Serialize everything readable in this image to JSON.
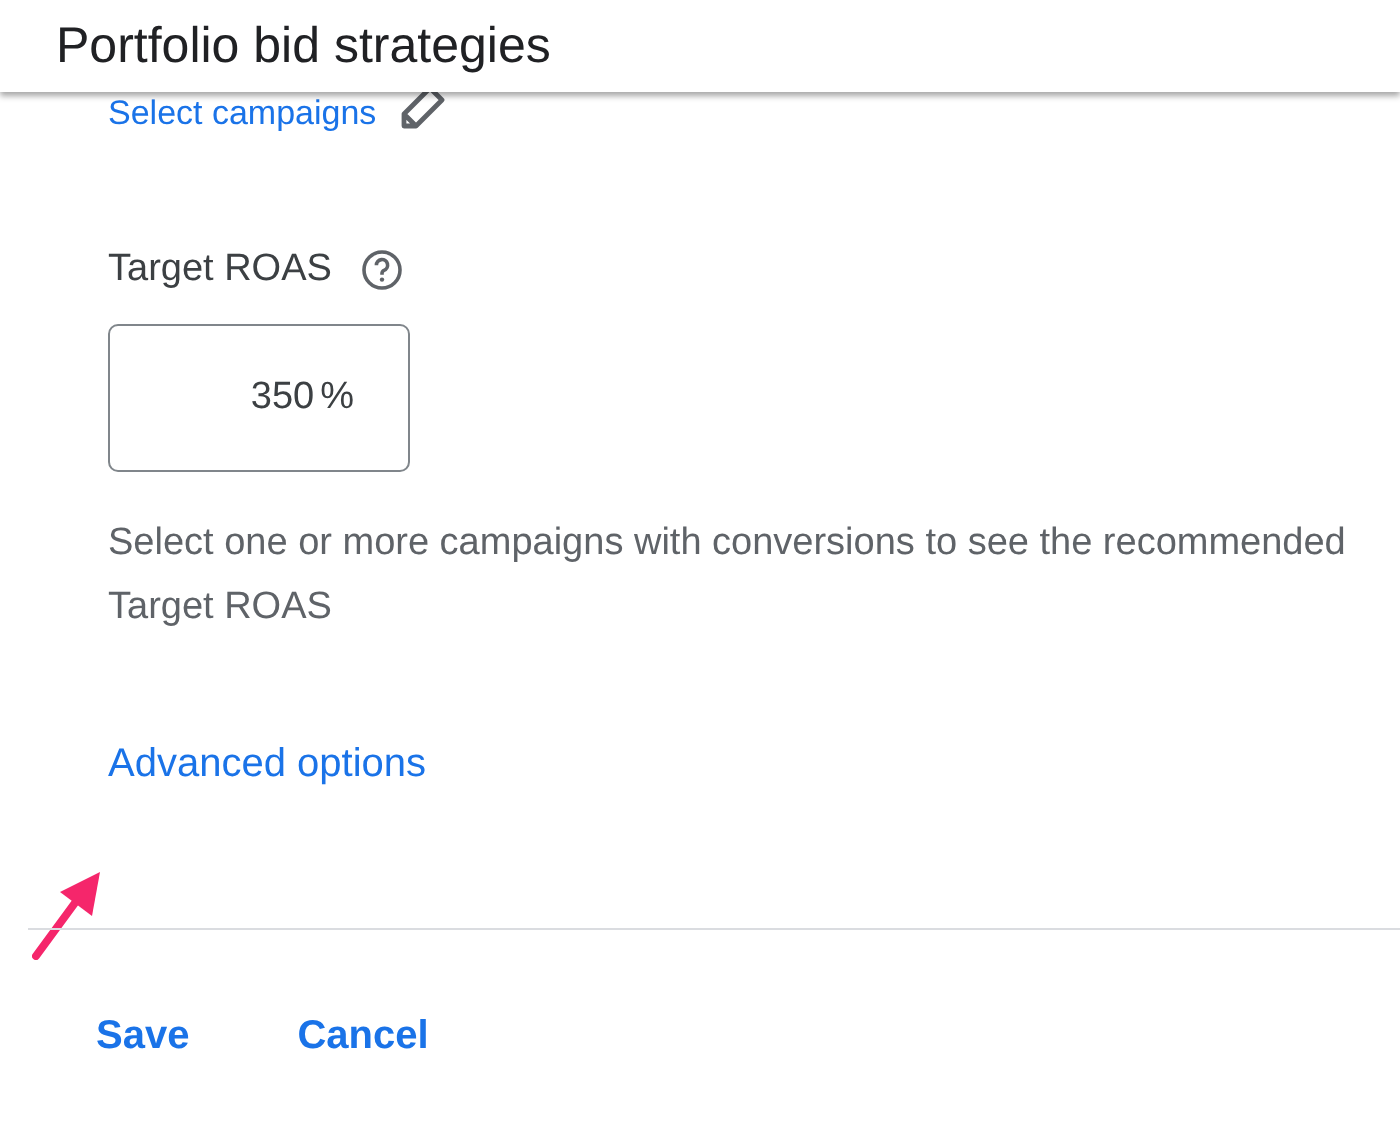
{
  "header": {
    "title": "Portfolio bid strategies"
  },
  "campaigns": {
    "link": "Select campaigns"
  },
  "target_roas": {
    "label": "Target ROAS",
    "value": "350",
    "suffix": "%",
    "help": "Select one or more campaigns with conversions to see the recommended Target ROAS"
  },
  "advanced": {
    "link": "Advanced options"
  },
  "buttons": [
    {
      "label": "Save"
    },
    {
      "label": "Cancel"
    }
  ]
}
